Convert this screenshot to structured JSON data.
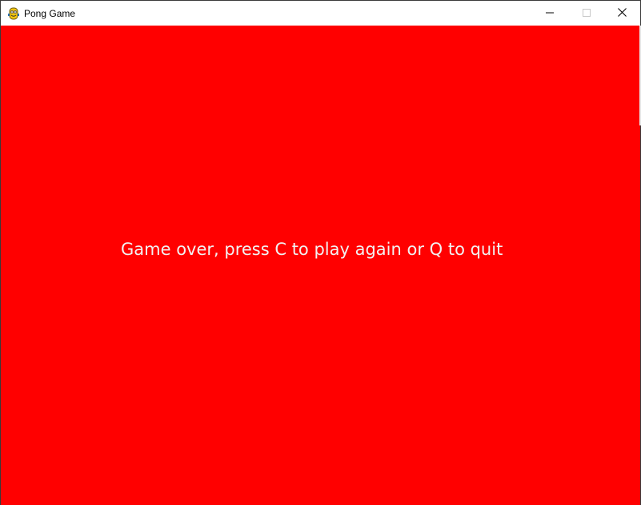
{
  "window": {
    "title": "Pong Game",
    "app_icon": "pygame-snake-icon",
    "controls": {
      "minimize_icon": "minimize-icon",
      "maximize_icon": "maximize-icon",
      "close_icon": "close-icon"
    }
  },
  "game": {
    "background_color": "#ff0000",
    "text_color": "#f2f2f2",
    "message": "Game over, press C to play again or Q to quit"
  }
}
